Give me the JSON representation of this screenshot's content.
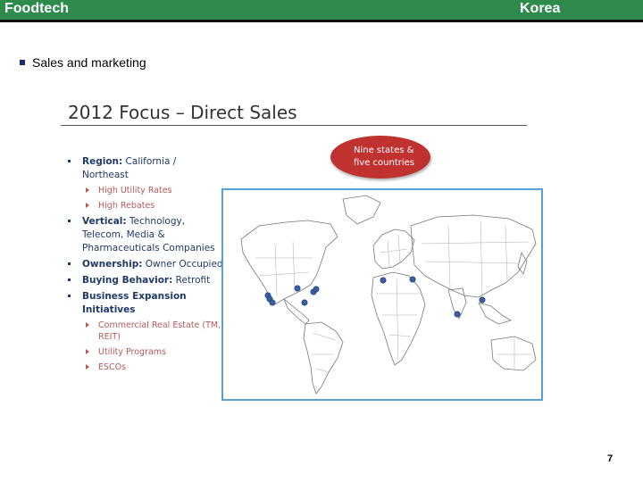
{
  "header": {
    "left_title": "Foodtech",
    "right_title": "Korea"
  },
  "section": {
    "label": "Sales and marketing"
  },
  "slide": {
    "title": "2012 Focus – Direct Sales",
    "bubble": {
      "line1": "Nine states &",
      "line2": "five countries"
    },
    "bullets": [
      {
        "head": "Region:",
        "text": " California / Northeast",
        "subs": [
          "High Utility Rates",
          "High Rebates"
        ]
      },
      {
        "head": "Vertical:",
        "text": " Technology, Telecom, Media & Pharmaceuticals Companies",
        "subs": []
      },
      {
        "head": "Ownership:",
        "text": " Owner Occupied",
        "subs": []
      },
      {
        "head": "Buying Behavior:",
        "text": " Retrofit",
        "subs": []
      },
      {
        "head": "Business Expansion Initiatives",
        "text": "",
        "subs": [
          "Commercial Real Estate (TM, REIT)",
          "Utility Programs",
          "ESCOs"
        ]
      }
    ]
  },
  "page_number": "7",
  "colors": {
    "header_bar": "#2f8a4d",
    "bubble": "#c0322f",
    "bullet_text": "#1f3a66",
    "sub_text": "#b55a5a",
    "map_border": "#5aa0d8",
    "map_dots": "#3a5fa8"
  }
}
